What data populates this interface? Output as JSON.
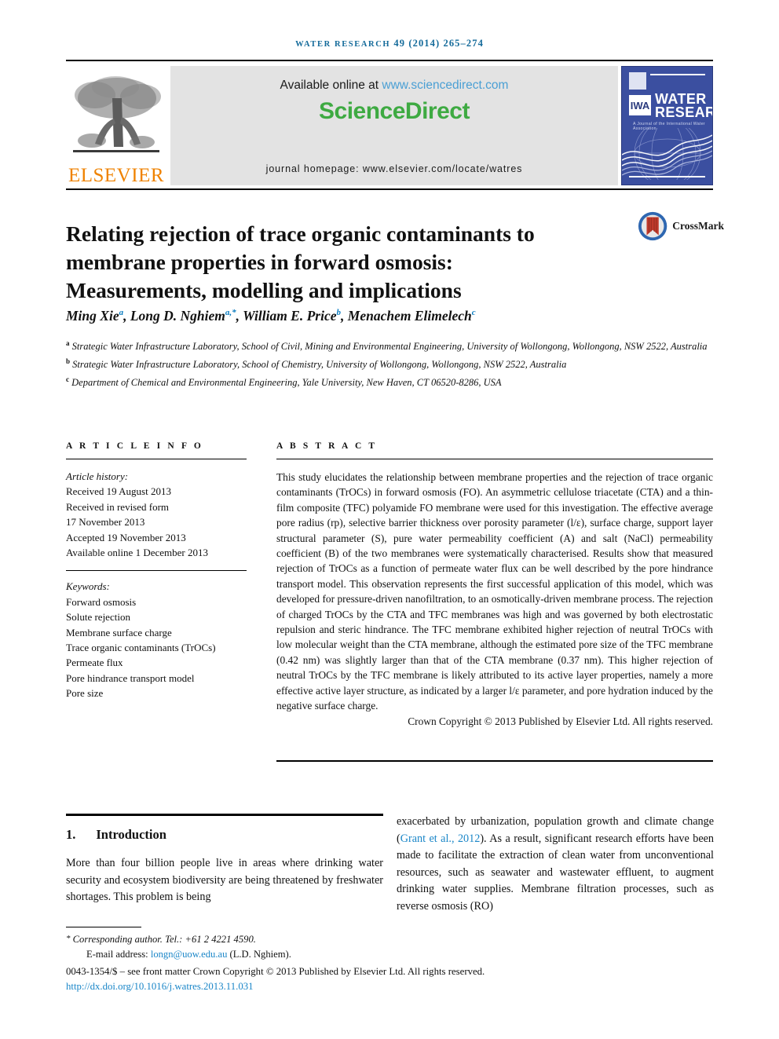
{
  "running_head": {
    "journal": "WATER RESEARCH",
    "citation": "49 (2014) 265–274"
  },
  "masthead": {
    "elsevier_wordmark": "ELSEVIER",
    "available_prefix": "Available online at ",
    "available_link": "www.sciencedirect.com",
    "sciencedirect_logo": "ScienceDirect",
    "journal_homepage": "journal homepage: www.elsevier.com/locate/watres",
    "cover": {
      "badge": "IWA",
      "title_line1": "WATER",
      "title_line2": "RESEARCH",
      "subtitle": "A Journal of the International Water Association"
    }
  },
  "article": {
    "title": "Relating rejection of trace organic contaminants to membrane properties in forward osmosis: Measurements, modelling and implications",
    "crossmark_label": "CrossMark",
    "authors_html": "Ming Xie<sup>a</sup>, Long D. Nghiem<sup>a,*</sup>, William E. Price<sup>b</sup>, Menachem Elimelech<sup>c</sup>",
    "affiliations": [
      {
        "marker": "a",
        "text": "Strategic Water Infrastructure Laboratory, School of Civil, Mining and Environmental Engineering, University of Wollongong, Wollongong, NSW 2522, Australia"
      },
      {
        "marker": "b",
        "text": "Strategic Water Infrastructure Laboratory, School of Chemistry, University of Wollongong, Wollongong, NSW 2522, Australia"
      },
      {
        "marker": "c",
        "text": "Department of Chemical and Environmental Engineering, Yale University, New Haven, CT 06520-8286, USA"
      }
    ]
  },
  "article_info": {
    "heading": "A R T I C L E   I N F O",
    "history_label": "Article history:",
    "history": [
      "Received 19 August 2013",
      "Received in revised form",
      "17 November 2013",
      "Accepted 19 November 2013",
      "Available online 1 December 2013"
    ],
    "keywords_label": "Keywords:",
    "keywords": [
      "Forward osmosis",
      "Solute rejection",
      "Membrane surface charge",
      "Trace organic contaminants (TrOCs)",
      "Permeate flux",
      "Pore hindrance transport model",
      "Pore size"
    ]
  },
  "abstract": {
    "heading": "A B S T R A C T",
    "text": "This study elucidates the relationship between membrane properties and the rejection of trace organic contaminants (TrOCs) in forward osmosis (FO). An asymmetric cellulose triacetate (CTA) and a thin-film composite (TFC) polyamide FO membrane were used for this investigation. The effective average pore radius (rp), selective barrier thickness over porosity parameter (l/ε), surface charge, support layer structural parameter (S), pure water permeability coefficient (A) and salt (NaCl) permeability coefficient (B) of the two membranes were systematically characterised. Results show that measured rejection of TrOCs as a function of permeate water flux can be well described by the pore hindrance transport model. This observation represents the first successful application of this model, which was developed for pressure-driven nanofiltration, to an osmotically-driven membrane process. The rejection of charged TrOCs by the CTA and TFC membranes was high and was governed by both electrostatic repulsion and steric hindrance. The TFC membrane exhibited higher rejection of neutral TrOCs with low molecular weight than the CTA membrane, although the estimated pore size of the TFC membrane (0.42 nm) was slightly larger than that of the CTA membrane (0.37 nm). This higher rejection of neutral TrOCs by the TFC membrane is likely attributed to its active layer properties, namely a more effective active layer structure, as indicated by a larger l/ε parameter, and pore hydration induced by the negative surface charge.",
    "copyright": "Crown Copyright © 2013 Published by Elsevier Ltd. All rights reserved."
  },
  "introduction": {
    "number": "1.",
    "title": "Introduction",
    "left_paragraph": "More than four billion people live in areas where drinking water security and ecosystem biodiversity are being threatened by freshwater shortages. This problem is being",
    "right_part1": "exacerbated by urbanization, population growth and climate change (",
    "right_citation": "Grant et al., 2012",
    "right_part2": "). As a result, significant research efforts have been made to facilitate the extraction of clean water from unconventional resources, such as seawater and wastewater effluent, to augment drinking water supplies. Membrane filtration processes, such as reverse osmosis (RO)"
  },
  "footer": {
    "corresponding_prefix": "Corresponding author. Tel.: ",
    "corresponding_phone": "+61 2 4221 4590.",
    "email_label": "E-mail address: ",
    "email": "longn@uow.edu.au",
    "email_suffix": " (L.D. Nghiem).",
    "issn_line": "0043-1354/$ – see front matter Crown Copyright © 2013 Published by Elsevier Ltd. All rights reserved.",
    "doi": "http://dx.doi.org/10.1016/j.watres.2013.11.031"
  }
}
